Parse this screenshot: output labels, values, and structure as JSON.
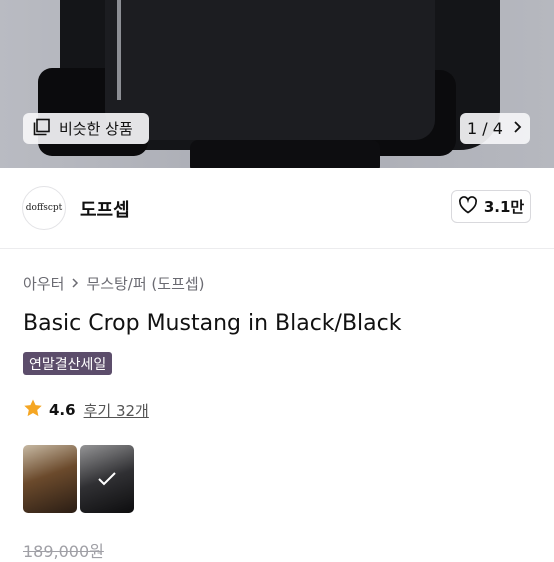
{
  "hero": {
    "similar_label": "비슷한 상품",
    "counter": "1 / 4"
  },
  "shop": {
    "logo_text": "doffscpt",
    "name": "도프셉",
    "likes": "3.1만"
  },
  "breadcrumb": [
    "아우터",
    "무스탕/퍼 (도프셉)"
  ],
  "product": {
    "title": "Basic Crop Mustang in Black/Black",
    "badge": "연말결산세일",
    "rating": "4.6",
    "reviews": "후기 32개",
    "price_original": "189,000원"
  },
  "icons": {
    "similar": "gallery-icon",
    "next": "chevron-right-icon",
    "like": "heart-icon",
    "rating": "star-icon",
    "breadcrumb_separator": "chevron-right-icon",
    "selected": "check-icon"
  },
  "colors": {
    "badge_bg": "#5c4d6b",
    "star": "#f5a623"
  }
}
